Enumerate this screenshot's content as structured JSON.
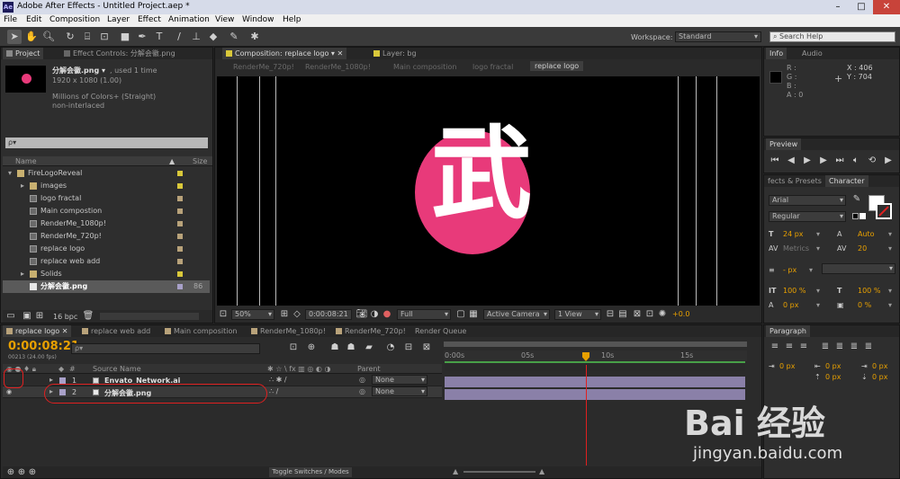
{
  "app": {
    "title": "Adobe After Effects - Untitled Project.aep *",
    "logo": "Ae",
    "colors": {
      "accent": "#e8a000",
      "pink": "#e83a7a",
      "cti": "#e02020",
      "label_yellow": "#d9c83a",
      "label_tan": "#b8a27a"
    }
  },
  "window_controls": {
    "minimize": "–",
    "maximize": "□",
    "close": "✕"
  },
  "menu": [
    "File",
    "Edit",
    "Composition",
    "Layer",
    "Effect",
    "Animation",
    "View",
    "Window",
    "Help"
  ],
  "toolbar": {
    "tools": [
      "select-tool-icon",
      "hand-tool-icon",
      "zoom-tool-icon",
      "rotate-tool-icon",
      "camera-orbit-icon",
      "pan-behind-icon",
      "rectangle-tool-icon",
      "pen-tool-icon",
      "text-tool-icon",
      "brush-tool-icon",
      "clone-stamp-icon",
      "eraser-icon",
      "roto-brush-icon",
      "puppet-pin-icon"
    ],
    "workspace_label": "Workspace:",
    "workspace_value": "Standard",
    "search_placeholder": "Search Help"
  },
  "project": {
    "tabs": [
      "Project",
      "Effect Controls: 分解会徽.png"
    ],
    "file_name": "分解会徽.png ▾",
    "used": ", used 1 time",
    "dims": "1920 x 1080 (1.00)",
    "colors": "Millions of Colors+ (Straight)",
    "interlace": "non-interlaced",
    "search_placeholder": "ρ▾",
    "col_name": "Name",
    "col_size": "Size",
    "items": [
      {
        "name": "FireLogoReveal",
        "type": "folder",
        "level": 0,
        "label": "#d9c83a"
      },
      {
        "name": "images",
        "type": "folder",
        "level": 1,
        "label": "#d9c83a"
      },
      {
        "name": "logo fractal",
        "type": "comp",
        "level": 1,
        "label": "#b8a27a"
      },
      {
        "name": "Main compostion",
        "type": "comp",
        "level": 1,
        "label": "#b8a27a"
      },
      {
        "name": "RenderMe_1080p!",
        "type": "comp",
        "level": 1,
        "label": "#b8a27a"
      },
      {
        "name": "RenderMe_720p!",
        "type": "comp",
        "level": 1,
        "label": "#b8a27a"
      },
      {
        "name": "replace logo",
        "type": "comp",
        "level": 1,
        "label": "#b8a27a"
      },
      {
        "name": "replace web add",
        "type": "comp",
        "level": 1,
        "label": "#b8a27a"
      },
      {
        "name": "Solids",
        "type": "folder",
        "level": 1,
        "label": "#d9c83a"
      },
      {
        "name": "分解会徽.png",
        "type": "image",
        "level": 1,
        "label": "#a8a0c8",
        "size": "86",
        "selected": true
      }
    ],
    "bpc": "16 bpc"
  },
  "comp": {
    "tabs": [
      "Composition: replace logo",
      "Layer: bg"
    ],
    "breadcrumbs": [
      "RenderMe_720p!",
      "RenderMe_1080p!",
      "Main composition",
      "logo fractal",
      "replace logo"
    ],
    "glyph": "武",
    "zoom": "50%",
    "timecode": "0:00:08:21",
    "resolution": "Full",
    "camera": "Active Camera",
    "view": "1 View",
    "exposure": "+0.0"
  },
  "info": {
    "tabs": [
      "Info",
      "Audio"
    ],
    "r": "R :",
    "g": "G :",
    "b": "B :",
    "a": "A : 0",
    "x": "X : 406",
    "y": "Y : 704"
  },
  "preview": {
    "tab": "Preview"
  },
  "character": {
    "tabs": [
      "fects & Presets",
      "Character"
    ],
    "font": "Arial",
    "style": "Regular",
    "size": "24 px",
    "leading": "Auto",
    "kerning": "Metrics",
    "tracking": "20",
    "stroke": "- px",
    "vscale": "100 %",
    "hscale": "100 %",
    "baseline": "0 px",
    "tsume": "0 %"
  },
  "paragraph": {
    "tab": "Paragraph",
    "indent_left": "0 px",
    "indent_right": "0 px",
    "indent_first": "0 px",
    "space_before": "0 px",
    "space_after": "0 px"
  },
  "timeline": {
    "tabs": [
      "replace logo",
      "replace web add",
      "Main composition",
      "RenderMe_1080p!",
      "RenderMe_720p!",
      "Render Queue"
    ],
    "timecode": "0:00:08:21",
    "frames": "00213 (24.00 fps)",
    "search_placeholder": "ρ▾",
    "col_source": "Source Name",
    "col_parent": "Parent",
    "ruler": [
      "0:00s",
      "05s",
      "10s",
      "15s"
    ],
    "layers": [
      {
        "num": "1",
        "name": "Envato_Network.ai",
        "parent": "None"
      },
      {
        "num": "2",
        "name": "分解会徽.png",
        "parent": "None"
      }
    ],
    "toggle_label": "Toggle Switches / Modes",
    "playhead_fraction": 0.47
  },
  "watermark": {
    "brand": "Bai 经验",
    "url": "jingyan.baidu.com"
  }
}
